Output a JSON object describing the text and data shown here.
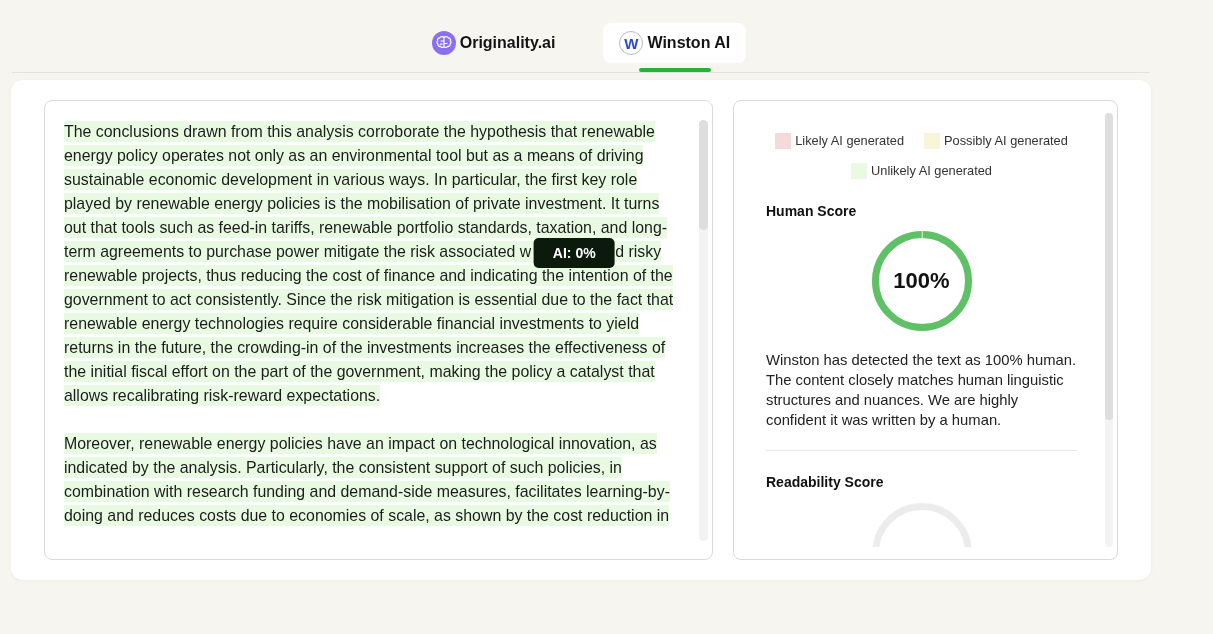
{
  "tabs": [
    {
      "label": "Originality.ai",
      "selected": false
    },
    {
      "label": "Winston AI",
      "selected": true,
      "icon_letter": "W"
    }
  ],
  "text_panel": {
    "paragraphs": [
      {
        "color": "#e8fbe2",
        "segments": [
          "The conclusions drawn from this analysis corroborate the hypothesis that renewable energy policy operates not only as an environmental tool but as a means of driving sustainable economic development in various ways. In particular, the first key role played by renewable energy policies is the mobilisation of private investment. It turns out that tools such as feed-in tariffs, renewable portfolio standards, taxation, and long-term agreements to purchase power mitigate the risk associated w",
          "d risky renewable projects, thus reducing the cost of finance and indicating the intention of the government to act consistently. Since the risk mitigation is essential due to the fact that renewable energy technologies require considerable financial investments to yield returns in the future, the crowding-in of the investments increases the effectiveness of the initial fiscal effort on the part of the government, making the policy a catalyst that allows recalibrating risk-reward expectations."
        ]
      },
      {
        "color": "#e8fbe2",
        "segments": [
          "Moreover, renewable energy policies have an impact on technological innovation, as indicated by the analysis. Particularly, the consistent support of such policies, in combination with research funding and demand-side measures, facilitates learning-by-doing and reduces costs due to economies of scale, as shown by the cost reduction in"
        ]
      }
    ],
    "tooltip": {
      "label": "AI: 0%"
    }
  },
  "results_panel": {
    "legend": [
      {
        "label": "Likely AI generated",
        "color": "#f5d9db"
      },
      {
        "label": "Possibly AI generated",
        "color": "#f8f5d9"
      },
      {
        "label": "Unlikely AI generated",
        "color": "#e8fbe2"
      }
    ],
    "human_score": {
      "title": "Human Score",
      "value": "100%",
      "level": 1,
      "description": "Winston has detected the text as 100% human. The content closely matches human linguistic structures and nuances. We are highly confident it was written by a human."
    },
    "readability_score": {
      "title": "Readability Score",
      "level": 0
    }
  }
}
